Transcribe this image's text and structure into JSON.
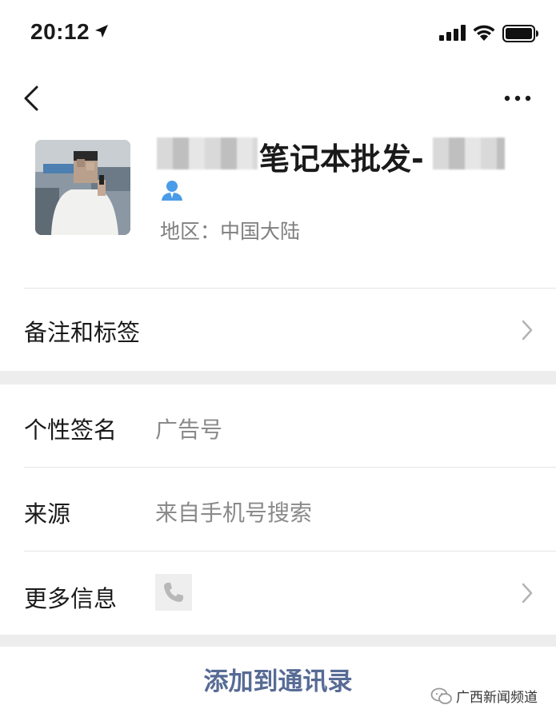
{
  "status_bar": {
    "time": "20:12",
    "icons": [
      "location-arrow-icon",
      "signal-icon",
      "wifi-icon",
      "battery-icon"
    ]
  },
  "nav": {
    "back_icon": "chevron-left-icon",
    "more_icon": "ellipsis-icon"
  },
  "profile": {
    "name_visible": "笔记本批发-",
    "region_label": "地区：中国大陆",
    "person_icon_color": "#4a9ce8"
  },
  "rows": {
    "remarks": {
      "label": "备注和标签"
    },
    "signature": {
      "label": "个性签名",
      "value": "广告号"
    },
    "source": {
      "label": "来源",
      "value": "来自手机号搜索"
    },
    "more_info": {
      "label": "更多信息",
      "icon": "phone-icon"
    }
  },
  "actions": {
    "add_contact": "添加到通讯录",
    "accent": "#576b95"
  },
  "watermark": {
    "text": "广西新闻频道"
  }
}
